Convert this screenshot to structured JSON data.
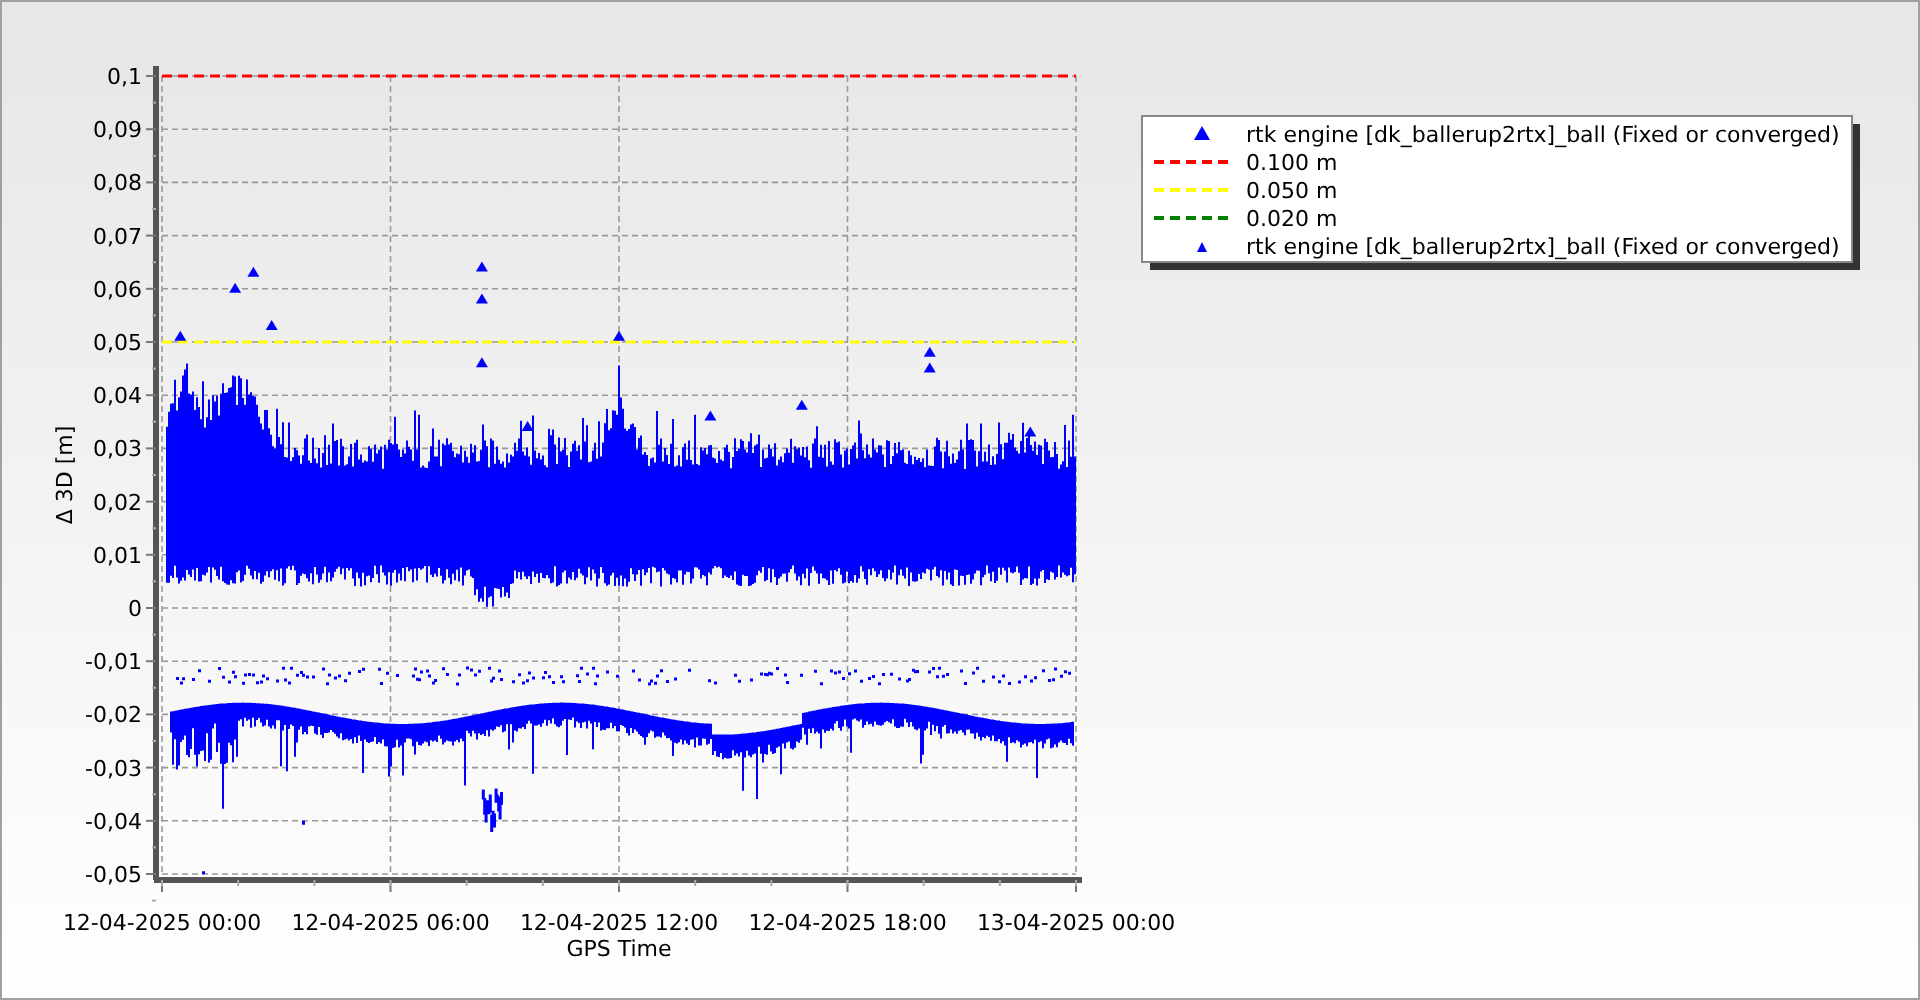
{
  "chart": {
    "chart_data": {
      "type": "line",
      "xlabel": "GPS Time",
      "ylabel": "Δ 3D [m]",
      "ylim": [
        -0.05,
        0.1
      ],
      "grid": true,
      "legend": "right",
      "categories": [
        "12-04-2025 00:00",
        "12-04-2025 06:00",
        "12-04-2025 12:00",
        "12-04-2025 18:00",
        "13-04-2025 00:00"
      ],
      "yticks": [
        {
          "value": 0.1,
          "label": "0,1"
        },
        {
          "value": 0.09,
          "label": "0,09"
        },
        {
          "value": 0.08,
          "label": "0,08"
        },
        {
          "value": 0.07,
          "label": "0,07"
        },
        {
          "value": 0.06,
          "label": "0,06"
        },
        {
          "value": 0.05,
          "label": "0,05"
        },
        {
          "value": 0.04,
          "label": "0,04"
        },
        {
          "value": 0.03,
          "label": "0,03"
        },
        {
          "value": 0.02,
          "label": "0,02"
        },
        {
          "value": 0.01,
          "label": "0,01"
        },
        {
          "value": 0,
          "label": "0"
        },
        {
          "value": -0.01,
          "label": "-0,01"
        },
        {
          "value": -0.02,
          "label": "-0,02"
        },
        {
          "value": -0.03,
          "label": "-0,03"
        },
        {
          "value": -0.04,
          "label": "-0,04"
        },
        {
          "value": -0.05,
          "label": "-0,05"
        }
      ],
      "series": [
        {
          "name": "0.100 m",
          "color": "#ff0000",
          "line_style": "dashed",
          "values": [
            0.1,
            0.1,
            0.1,
            0.1,
            0.1
          ]
        },
        {
          "name": "0.050 m",
          "color": "#ffff00",
          "line_style": "dashed",
          "values": [
            0.05,
            0.05,
            0.05,
            0.05,
            0.05
          ]
        }
      ]
    },
    "legend_line_entry": {
      "kind": "dash",
      "label": "0.020 m",
      "color": "#008000"
    },
    "legend_top": {
      "kind": "marker",
      "label": "rtk engine [dk_ballerup2rtx]_ball (Fixed or converged)",
      "color": "#0000ff"
    },
    "legend_bottom": {
      "kind": "small-marker",
      "label": "rtk engine [dk_ballerup2rtx]_ball (Fixed or converged)",
      "color": "#0000ff"
    }
  }
}
